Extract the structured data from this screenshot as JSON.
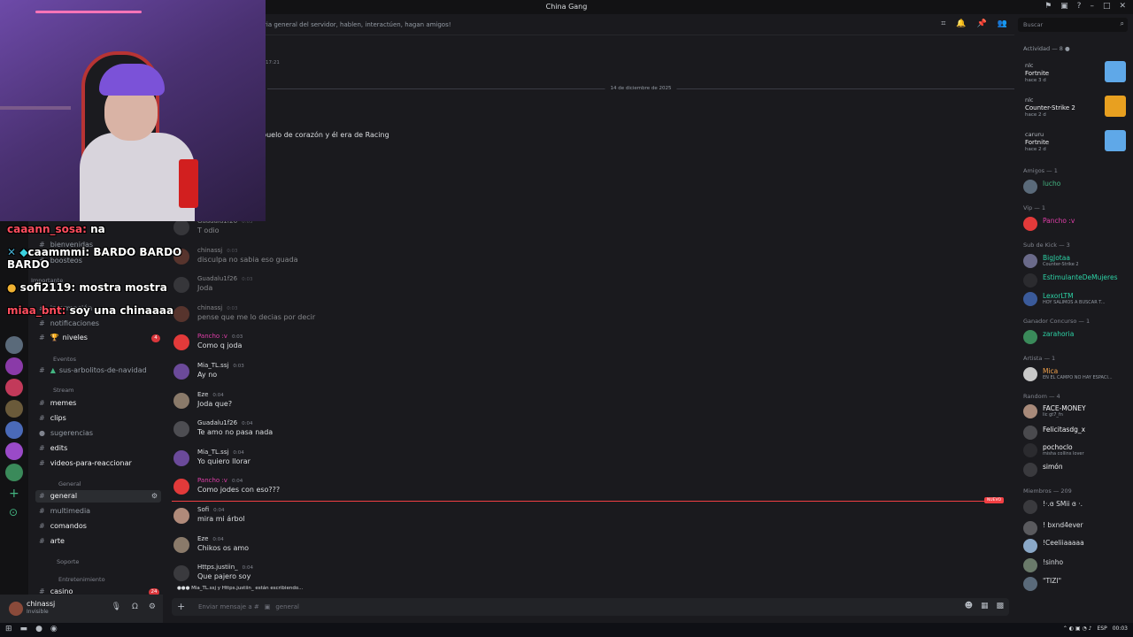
{
  "window": {
    "title": "China Gang"
  },
  "header": {
    "topic": "ria general del servidor, hablen, interactúen, hagan amigos!",
    "search_placeholder": "Buscar"
  },
  "channels": {
    "items": [
      {
        "label": "bienvenidas",
        "type": "text",
        "bold": false
      },
      {
        "label": "boosteos",
        "type": "text",
        "bold": false
      },
      {
        "label": "Importante",
        "type": "category"
      },
      {
        "label": "información",
        "type": "text",
        "bold": false,
        "badge": "1"
      },
      {
        "label": "notificaciones",
        "type": "text",
        "bold": false
      },
      {
        "label": "niveles",
        "type": "text",
        "bold": true,
        "badge": "4"
      },
      {
        "label": "Eventos",
        "type": "category"
      },
      {
        "label": "sus-arbolitos-de-navidad",
        "type": "text",
        "bold": false
      },
      {
        "label": "Stream",
        "type": "category"
      },
      {
        "label": "memes",
        "type": "text",
        "bold": true
      },
      {
        "label": "clips",
        "type": "text",
        "bold": true
      },
      {
        "label": "sugerencias",
        "type": "text",
        "bold": false
      },
      {
        "label": "edits",
        "type": "text",
        "bold": true
      },
      {
        "label": "videos-para-reaccionar",
        "type": "text",
        "bold": true
      },
      {
        "label": "General",
        "type": "category"
      },
      {
        "label": "general",
        "type": "text",
        "bold": true,
        "selected": true
      },
      {
        "label": "multimedia",
        "type": "text",
        "bold": false
      },
      {
        "label": "comandos",
        "type": "text",
        "bold": true
      },
      {
        "label": "arte",
        "type": "text",
        "bold": true
      },
      {
        "label": "Soporte",
        "type": "category"
      },
      {
        "label": "Entretenimiento",
        "type": "category"
      },
      {
        "label": "casino",
        "type": "text",
        "bold": true,
        "badge": "24"
      }
    ]
  },
  "user_panel": {
    "name": "chinassj",
    "status": "Invisible"
  },
  "chat": {
    "early_time": "17:21",
    "early_fragment": "a",
    "early_message": "buelo de corazón y él era de Racing",
    "date_divider": "14 de diciembre de 2025",
    "messages": [
      {
        "author": "Guadalu1f26",
        "time": "0:03",
        "text": "T odio",
        "color": "#dbdee1",
        "av": "#4d4d52"
      },
      {
        "author": "chinassj",
        "time": "0:03",
        "text": "disculpa no sabia eso guada",
        "color": "#dbdee1",
        "av": "#8a4a3a"
      },
      {
        "author": "Guadalu1f26",
        "time": "0:03",
        "text": "Joda",
        "color": "#dbdee1",
        "av": "#4d4d52"
      },
      {
        "author": "chinassj",
        "time": "0:03",
        "text": "pense que me lo decias por decir",
        "color": "#dbdee1",
        "av": "#8a4a3a"
      },
      {
        "author": "Pancho :v",
        "time": "0:03",
        "text": "Como q joda",
        "color": "#e03ea9",
        "av": "#e23a3a"
      },
      {
        "author": "Mia_TL.ssj",
        "time": "0:03",
        "text": "Ay no",
        "color": "#dbdee1",
        "av": "#6b4a9a"
      },
      {
        "author": "Eze",
        "time": "0:04",
        "text": "Joda que?",
        "color": "#dbdee1",
        "av": "#8a7a6a"
      },
      {
        "author": "Guadalu1f26",
        "time": "0:04",
        "text": "Te amo no pasa nada",
        "color": "#dbdee1",
        "av": "#4d4d52"
      },
      {
        "author": "Mia_TL.ssj",
        "time": "0:04",
        "text": "Yo quiero llorar",
        "color": "#dbdee1",
        "av": "#6b4a9a"
      },
      {
        "author": "Pancho :v",
        "time": "0:04",
        "text": "Como jodes con eso???",
        "color": "#e03ea9",
        "av": "#e23a3a"
      },
      {
        "author": "Sofi",
        "time": "0:04",
        "text": "mira mi árbol",
        "color": "#dbdee1",
        "av": "#b08a7a"
      },
      {
        "author": "Eze",
        "time": "0:04",
        "text": "Chikos os amo",
        "color": "#dbdee1",
        "av": "#8a7a6a"
      },
      {
        "author": "Https.justiin_",
        "time": "0:04",
        "text": "Que pajero soy",
        "color": "#dbdee1",
        "av": "#3a3a3e"
      }
    ],
    "new_label": "NUEVO",
    "typing": "Mia_TL.ssj y Https.justiin_ están escribiendo...",
    "composer_placeholder": "Enviar mensaje a #",
    "composer_channel": "general"
  },
  "activity": {
    "heading": "Actividad — 8",
    "items": [
      {
        "who": "nlc",
        "game": "Fortnite",
        "ago": "hace 3 d",
        "thumb": "#5fa8e8"
      },
      {
        "who": "nlc",
        "game": "Counter-Strike 2",
        "ago": "hace 2 d",
        "thumb": "#e8a020"
      },
      {
        "who": "caruru",
        "game": "Fortnite",
        "ago": "hace 2 d",
        "thumb": "#5fa8e8"
      }
    ]
  },
  "members": {
    "groups": [
      {
        "label": "Amigos — 1",
        "members": [
          {
            "name": "lucho",
            "color": "#43b581",
            "sub": ""
          }
        ]
      },
      {
        "label": "Vip — 1",
        "members": [
          {
            "name": "Pancho :v",
            "color": "#e03ea9",
            "sub": ""
          }
        ]
      },
      {
        "label": "Sub de Kick — 3",
        "members": [
          {
            "name": "BigJotaa",
            "color": "#2dd4a7",
            "sub": "Counter-Strike 2"
          },
          {
            "name": "EstimulanteDeMujeres",
            "color": "#2dd4a7",
            "sub": ""
          },
          {
            "name": "LexorLTM",
            "color": "#2dd4a7",
            "sub": "HOY SALIMOS A BUSCAR T..."
          }
        ]
      },
      {
        "label": "Ganador Concurso — 1",
        "members": [
          {
            "name": "zarahoria",
            "color": "#2dd4a7",
            "sub": ""
          }
        ]
      },
      {
        "label": "Artista — 1",
        "members": [
          {
            "name": "Mica",
            "color": "#f0a04a",
            "sub": "EN EL CAMPO NO HAY ESPACI..."
          }
        ]
      },
      {
        "label": "Random — 4",
        "members": [
          {
            "name": "FACE-MONEY",
            "color": "#f2f3f5",
            "sub": "lic gt7_fn"
          },
          {
            "name": "Felicitasdg_x",
            "color": "#f2f3f5",
            "sub": ""
          },
          {
            "name": "pochoclo",
            "color": "#f2f3f5",
            "sub": "misha collins lover"
          },
          {
            "name": "simón",
            "color": "#f2f3f5",
            "sub": ""
          }
        ]
      },
      {
        "label": "Miembros — 209",
        "members": [
          {
            "name": "!·.ɞ SMii ɞ ·.",
            "color": "#dbdee1",
            "sub": ""
          },
          {
            "name": "! bxnd4ever",
            "color": "#dbdee1",
            "sub": ""
          },
          {
            "name": "!Ceeliiaaaaa",
            "color": "#dbdee1",
            "sub": ""
          },
          {
            "name": "!sinho",
            "color": "#dbdee1",
            "sub": ""
          },
          {
            "name": "\"TIZI\"",
            "color": "#dbdee1",
            "sub": ""
          }
        ]
      }
    ]
  },
  "stream_overlay": {
    "lines": [
      {
        "user": "caaann_sosa:",
        "text": "na"
      },
      {
        "user": "caammmi:",
        "text": "BARDO BARDO BARDO",
        "color": "#fff"
      },
      {
        "user": "sofi2119:",
        "text": "mostra mostra",
        "color": "#fff"
      },
      {
        "user": "miaa_bnt:",
        "text": "soy una chinaaaa"
      }
    ]
  },
  "taskbar": {
    "lang": "ESP",
    "time": "00:03"
  }
}
